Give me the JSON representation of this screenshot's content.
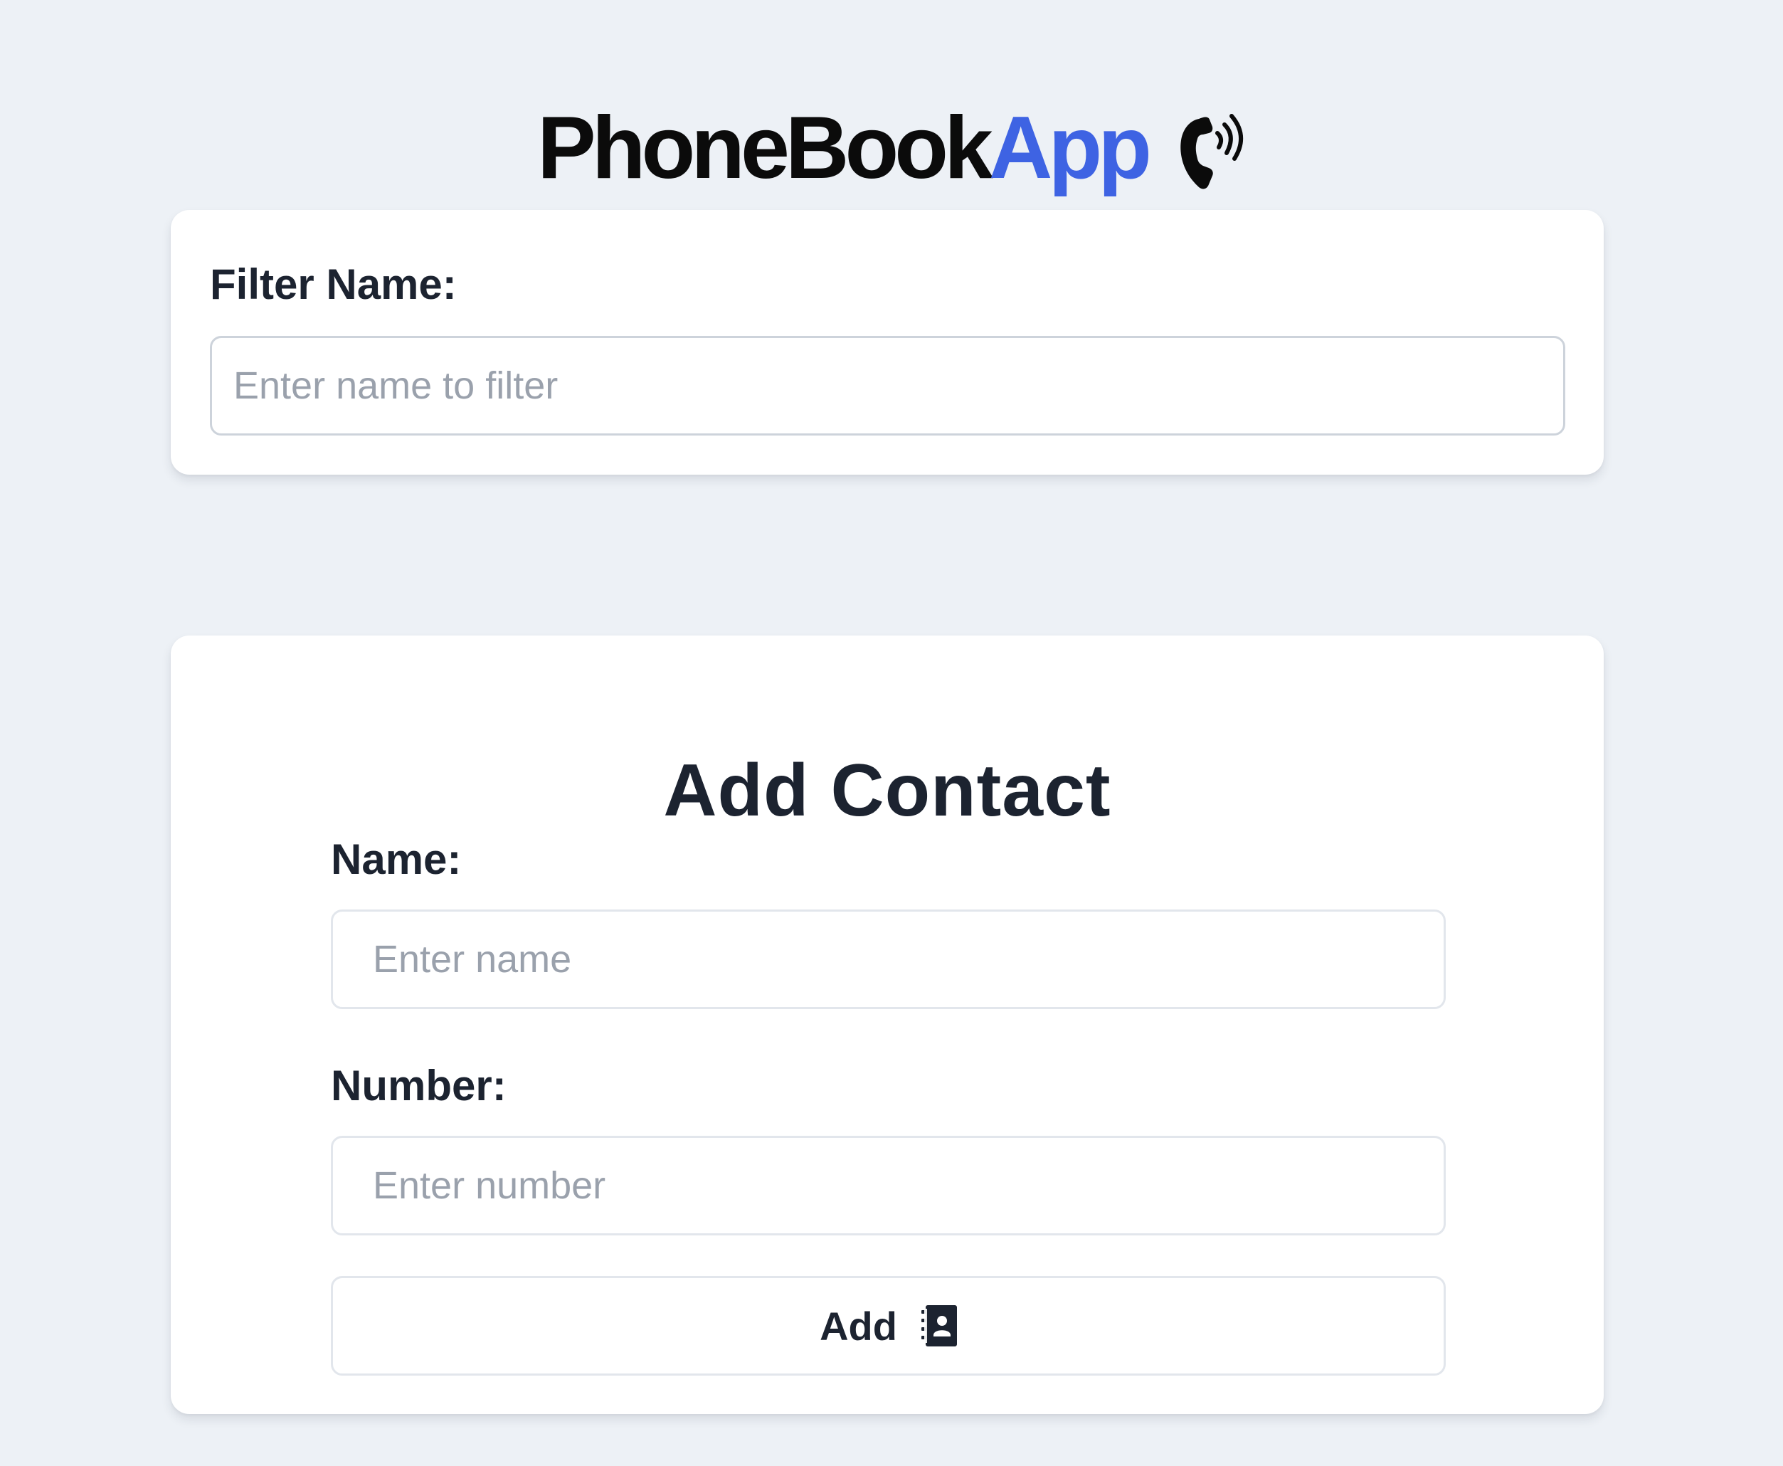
{
  "header": {
    "title_main": "PhoneBook",
    "title_accent": "App",
    "icon": "phone-ringing-icon",
    "accent_color": "#3e63e3"
  },
  "filter": {
    "label": "Filter Name:",
    "placeholder": "Enter name to filter",
    "value": ""
  },
  "add_contact": {
    "heading": "Add Contact",
    "name_label": "Name:",
    "name_placeholder": "Enter name",
    "name_value": "",
    "number_label": "Number:",
    "number_placeholder": "Enter number",
    "number_value": "",
    "button_label": "Add",
    "button_icon": "contact-book-icon"
  },
  "colors": {
    "background": "#edf1f6",
    "card": "#ffffff",
    "text": "#1c2330",
    "placeholder": "#9aa1ac"
  }
}
